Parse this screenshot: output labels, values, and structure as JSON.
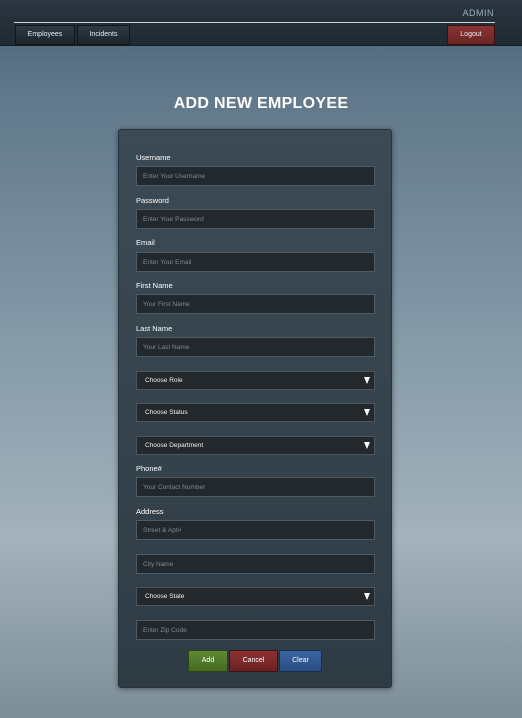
{
  "header": {
    "user_label": "ADMIN",
    "nav": {
      "employees": "Employees",
      "incidents": "Incidents",
      "logout": "Logout"
    }
  },
  "page": {
    "title": "ADD NEW EMPLOYEE"
  },
  "form": {
    "username": {
      "label": "Username",
      "placeholder": "Enter Your Username",
      "value": ""
    },
    "password": {
      "label": "Password",
      "placeholder": "Enter Your Password",
      "value": ""
    },
    "email": {
      "label": "Email",
      "placeholder": "Enter Your Email",
      "value": ""
    },
    "first_name": {
      "label": "First Name",
      "placeholder": "Your First Name",
      "value": ""
    },
    "last_name": {
      "label": "Last Name",
      "placeholder": "Your Last Name",
      "value": ""
    },
    "role": {
      "selected": "Choose Role"
    },
    "status": {
      "selected": "Choose Status"
    },
    "department": {
      "selected": "Choose Department"
    },
    "phone": {
      "label": "Phone#",
      "placeholder": "Your Contact Number",
      "value": ""
    },
    "address": {
      "label": "Address",
      "placeholder": "Street & Apt#",
      "value": ""
    },
    "city": {
      "placeholder": "City Name",
      "value": ""
    },
    "state": {
      "selected": "Choose State"
    },
    "zip": {
      "placeholder": "Enter Zip Code",
      "value": ""
    },
    "buttons": {
      "add": "Add",
      "cancel": "Cancel",
      "clear": "Clear"
    }
  },
  "colors": {
    "add": "#4f7a2b",
    "cancel": "#7a2a2a",
    "clear": "#2f5a92",
    "logout": "#7a2c2c"
  }
}
